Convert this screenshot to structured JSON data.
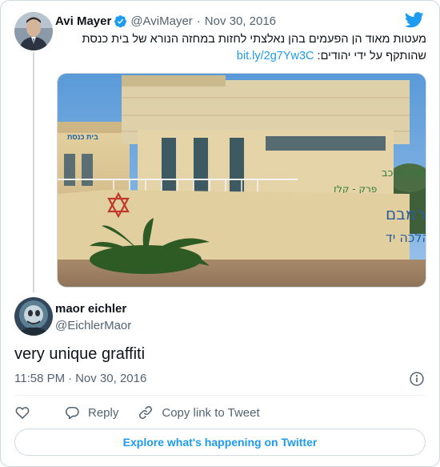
{
  "quoted_tweet": {
    "author_name": "Avi Mayer",
    "author_handle": "@AviMayer",
    "separator": "·",
    "date": "Nov 30, 2016",
    "text": "מעטות מאוד הן הפעמים בהן נאלצתי לחזות במחזה הנורא של בית כנסת שהותקף על ידי יהודים:",
    "link": "bit.ly/2g7Yw3C",
    "verified": true,
    "image": {
      "sign_text": "בית כנסת",
      "graffiti_lines": [
        "תהילים פסוק-נא-כב",
        "פרק - קלז",
        "רמבם",
        "הלכות-תשובה פרק ג - הלכה יד"
      ]
    }
  },
  "reply": {
    "author_name": "maor eichler",
    "author_handle": "@EichlerMaor",
    "text": "very unique graffiti",
    "time": "11:58 PM",
    "separator": "·",
    "date": "Nov 30, 2016"
  },
  "actions": {
    "reply_label": "Reply",
    "copy_link_label": "Copy link to Tweet"
  },
  "explore_label": "Explore what's happening on Twitter",
  "colors": {
    "accent": "#1d9bf0",
    "secondary_text": "#536471",
    "border": "#cfd9de"
  },
  "icons": [
    "verified-badge-icon",
    "twitter-bird-icon",
    "info-icon",
    "heart-icon",
    "reply-bubble-icon",
    "link-icon"
  ]
}
